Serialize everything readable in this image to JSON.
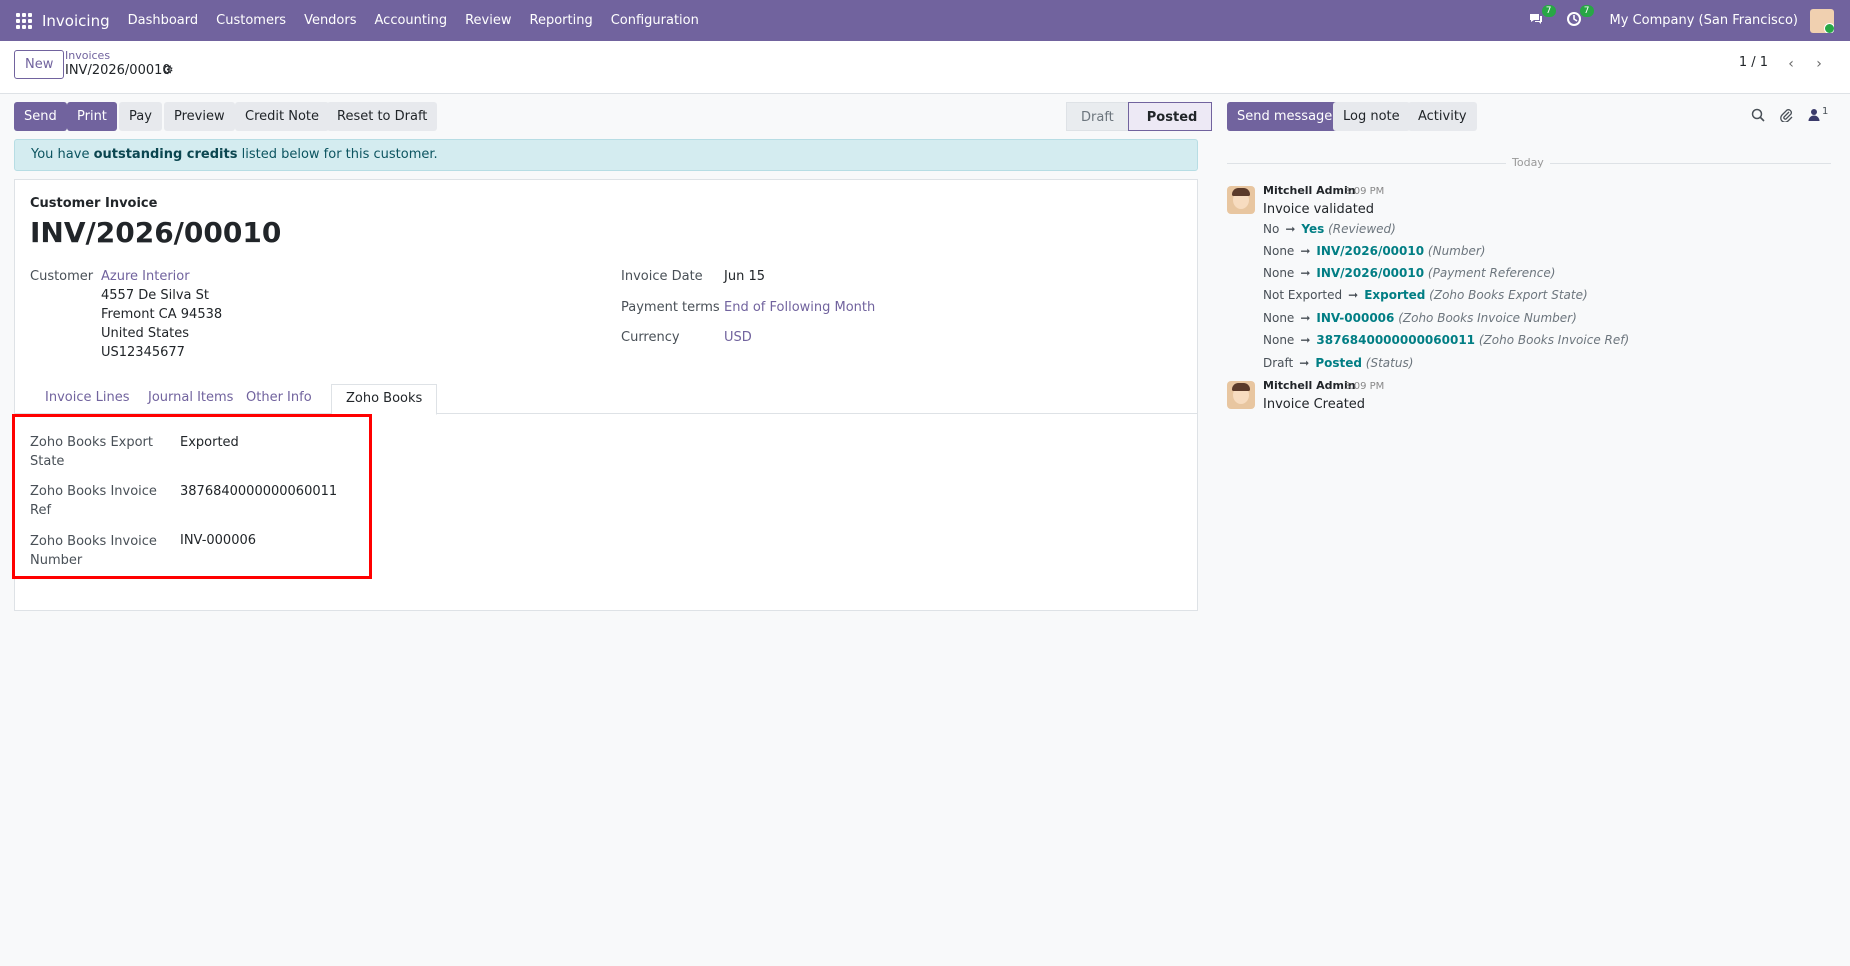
{
  "navbar": {
    "app_name": "Invoicing",
    "menu": [
      "Dashboard",
      "Customers",
      "Vendors",
      "Accounting",
      "Review",
      "Reporting",
      "Configuration"
    ],
    "messages_badge": "7",
    "activity_badge": "7",
    "company": "My Company (San Francisco)"
  },
  "control": {
    "new_label": "New",
    "breadcrumb_parent": "Invoices",
    "breadcrumb_current": "INV/2026/00010",
    "pager": "1 / 1"
  },
  "actions": {
    "send": "Send",
    "print": "Print",
    "pay": "Pay",
    "preview": "Preview",
    "credit_note": "Credit Note",
    "reset_to_draft": "Reset to Draft"
  },
  "statusbar": {
    "draft": "Draft",
    "posted": "Posted"
  },
  "alert": {
    "prefix": "You have",
    "strong": "outstanding credits",
    "suffix": "listed below for this customer."
  },
  "invoice": {
    "type_label": "Customer Invoice",
    "number": "INV/2026/00010",
    "customer_label": "Customer",
    "customer_name": "Azure Interior",
    "address_line1": "4557 De Silva St",
    "address_line2": "Fremont CA 94538",
    "address_line3": "United States",
    "address_line4": "US12345677",
    "invoice_date_label": "Invoice Date",
    "invoice_date": "Jun 15",
    "payment_terms_label": "Payment terms",
    "payment_terms": "End of Following Month",
    "currency_label": "Currency",
    "currency": "USD"
  },
  "tabs": [
    "Invoice Lines",
    "Journal Items",
    "Other Info",
    "Zoho Books"
  ],
  "zoho": {
    "export_state_label_1": "Zoho Books Export",
    "export_state_label_2": "State",
    "export_state": "Exported",
    "invoice_ref_label_1": "Zoho Books Invoice",
    "invoice_ref_label_2": "Ref",
    "invoice_ref": "3876840000000060011",
    "invoice_number_label_1": "Zoho Books Invoice",
    "invoice_number_label_2": "Number",
    "invoice_number": "INV-000006"
  },
  "chatter": {
    "send_message": "Send message",
    "log_note": "Log note",
    "activity": "Activity",
    "followers_count": "1",
    "today": "Today",
    "messages": [
      {
        "author": "Mitchell Admin",
        "time": "3:09 PM",
        "body": "Invoice validated",
        "tracking": [
          {
            "old": "No",
            "new": "Yes",
            "field": "(Reviewed)"
          },
          {
            "old": "None",
            "new": "INV/2026/00010",
            "field": "(Number)"
          },
          {
            "old": "None",
            "new": "INV/2026/00010",
            "field": "(Payment Reference)"
          },
          {
            "old": "Not Exported",
            "new": "Exported",
            "field": "(Zoho Books Export State)"
          },
          {
            "old": "None",
            "new": "INV-000006",
            "field": "(Zoho Books Invoice Number)"
          },
          {
            "old": "None",
            "new": "3876840000000060011",
            "field": "(Zoho Books Invoice Ref)"
          },
          {
            "old": "Draft",
            "new": "Posted",
            "field": "(Status)"
          }
        ]
      },
      {
        "author": "Mitchell Admin",
        "time": "3:09 PM",
        "body": "Invoice Created",
        "tracking": []
      }
    ]
  },
  "colors": {
    "brand": "#71639e",
    "tracking_link": "#017e84",
    "highlight": "#ff0000",
    "alert_bg": "#d4ecf0"
  }
}
